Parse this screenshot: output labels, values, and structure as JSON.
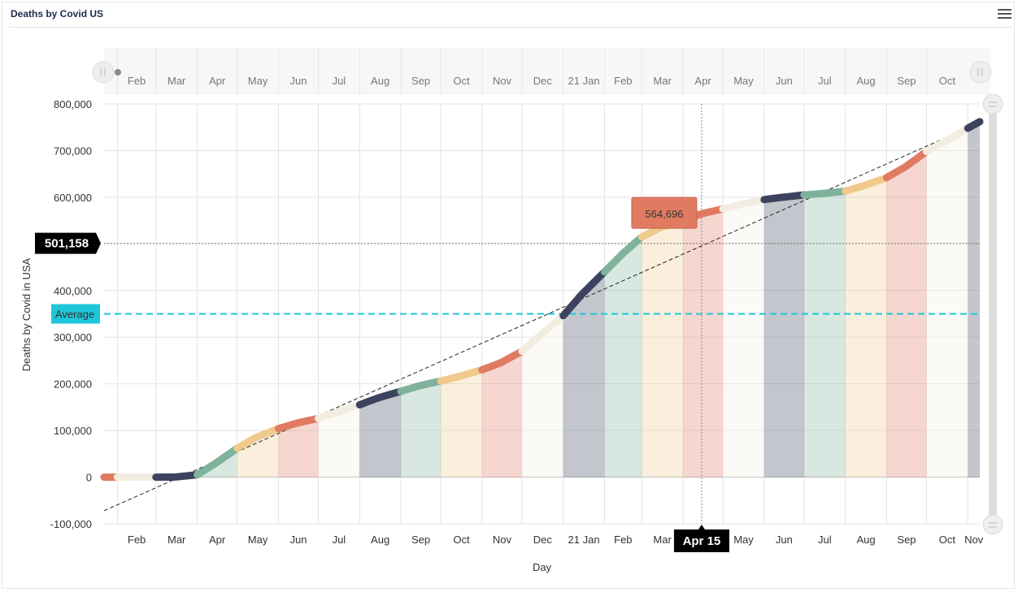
{
  "panel": {
    "title": "Deaths by Covid US"
  },
  "chart_data": {
    "type": "line",
    "title": "",
    "xlabel": "Day",
    "ylabel": "Deaths by Covid in USA",
    "ylim": [
      -100000,
      800000
    ],
    "yticks": [
      "-100,000",
      "0",
      "100,000",
      "200,000",
      "300,000",
      "400,000",
      "500,000",
      "600,000",
      "700,000",
      "800,000"
    ],
    "x_tick_labels": [
      "Feb",
      "Mar",
      "Apr",
      "May",
      "Jun",
      "Jul",
      "Aug",
      "Sep",
      "Oct",
      "Nov",
      "Dec",
      "21 Jan",
      "Feb",
      "Mar",
      "Apr",
      "May",
      "Jun",
      "Jul",
      "Aug",
      "Sep",
      "Oct",
      "Nov"
    ],
    "navigator_labels": [
      "Feb",
      "Mar",
      "Apr",
      "May",
      "Jun",
      "Jul",
      "Aug",
      "Sep",
      "Oct",
      "Nov",
      "Dec",
      "21 Jan",
      "Feb",
      "Mar",
      "Apr",
      "May",
      "Jun",
      "Jul",
      "Aug",
      "Sep",
      "Oct"
    ],
    "month_colors": [
      "#e07b62",
      "#f2ede0",
      "#3d425e",
      "#7fb29a",
      "#f0c98c",
      "#e07b62",
      "#f2ede0",
      "#3d425e",
      "#7fb29a",
      "#f0c98c",
      "#e07b62",
      "#f2ede0",
      "#3d425e",
      "#7fb29a",
      "#f0c98c",
      "#e07b62",
      "#f2ede0",
      "#3d425e",
      "#7fb29a",
      "#f0c98c",
      "#e07b62",
      "#f2ede0",
      "#3d425e"
    ],
    "series": [
      {
        "x": [
          "2020-01-22",
          "2020-02-01",
          "2020-03-01",
          "2020-03-15",
          "2020-04-01",
          "2020-04-15",
          "2020-05-01",
          "2020-05-15",
          "2020-06-01",
          "2020-06-15",
          "2020-07-01",
          "2020-07-15",
          "2020-08-01",
          "2020-08-15",
          "2020-09-01",
          "2020-09-15",
          "2020-10-01",
          "2020-10-15",
          "2020-11-01",
          "2020-11-15",
          "2020-12-01",
          "2020-12-15",
          "2021-01-01",
          "2021-01-15",
          "2021-02-01",
          "2021-02-15",
          "2021-03-01",
          "2021-03-15",
          "2021-04-01",
          "2021-04-15",
          "2021-05-01",
          "2021-05-15",
          "2021-06-01",
          "2021-06-15",
          "2021-07-01",
          "2021-07-15",
          "2021-08-01",
          "2021-08-15",
          "2021-09-01",
          "2021-09-15",
          "2021-10-01",
          "2021-10-15",
          "2021-11-01",
          "2021-11-10"
        ],
        "y": [
          0,
          0,
          0,
          50,
          5000,
          30000,
          62000,
          85000,
          104000,
          116000,
          126000,
          139000,
          155000,
          170000,
          184000,
          196000,
          206000,
          216000,
          230000,
          245000,
          270000,
          305000,
          346000,
          392000,
          440000,
          480000,
          515000,
          535000,
          550000,
          564696,
          575000,
          585000,
          595000,
          600000,
          605000,
          608000,
          613000,
          625000,
          642000,
          665000,
          698000,
          720000,
          748000,
          762000
        ]
      }
    ],
    "average": {
      "label": "Average",
      "value": 350000,
      "color": "#1ec6d9"
    },
    "crosshair": {
      "y_label": "501,158",
      "y_value": 501158,
      "x_label": "Apr 15",
      "x_value": "2021-04-15"
    },
    "tooltip": {
      "text": "564,696",
      "x": "2021-04-15",
      "y": 564696
    },
    "trend_line": {
      "from": [
        "2020-01-22",
        -72000
      ],
      "to": [
        "2021-11-10",
        760000
      ]
    },
    "grid": true
  }
}
